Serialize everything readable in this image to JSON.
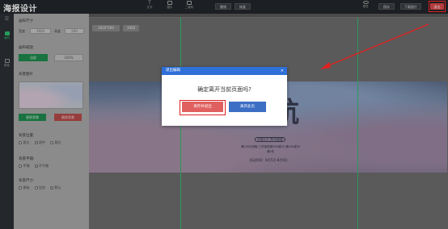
{
  "app": {
    "logo": "海报设计"
  },
  "toolbar": {
    "tools": [
      {
        "label": "文字",
        "icon": "text-icon"
      },
      {
        "label": "图片",
        "icon": "image-icon"
      },
      {
        "label": "二维码",
        "icon": "qrcode-icon"
      }
    ],
    "undo_label": "撤销",
    "redo_label": "恢复",
    "preview_label": "预览",
    "save_label": "保存",
    "download_label": "下载图片",
    "exit_label": "退出"
  },
  "strip": {
    "items": [
      {
        "label": "",
        "icon": "menu-icon"
      },
      {
        "label": "画布",
        "icon": "canvas-icon"
      },
      {
        "label": "模板",
        "icon": "template-icon"
      }
    ]
  },
  "panel": {
    "canvas_size": {
      "title": "画布尺寸",
      "width_label": "宽度",
      "width_value": "1920",
      "height_label": "高度",
      "height_value": "500"
    },
    "canvas_zoom": {
      "title": "画布缩放",
      "fit_label": "适屏",
      "full_label": "100%"
    },
    "bg_image": {
      "title": "背景图片",
      "replace_label": "更换背景",
      "delete_label": "删除背景"
    },
    "bg_position": {
      "title": "背景位置:",
      "options": [
        "居左",
        "居中",
        "居右"
      ],
      "selected": 1
    },
    "bg_repeat": {
      "title": "背景平铺:",
      "options": [
        "平铺",
        "不平铺"
      ],
      "selected": 1
    },
    "bg_size": {
      "title": "背景尺寸:",
      "options": [
        "原始",
        "包含",
        "默认"
      ],
      "selected": 2
    }
  },
  "canvas": {
    "size_tags": [
      "1920*500",
      "1920"
    ],
    "banner": {
      "title": "启航",
      "slogan": "约惠七夕 '购'你浪漫",
      "line1": "满199元领取 三件家居满199减20 满299减30",
      "line2": "满2件",
      "activity": "活动时间：8月5日-8月9日"
    }
  },
  "dialog": {
    "title": "退出编辑",
    "close": "×",
    "message": "确定离开当前页面吗?",
    "save_exit_label": "保存并退出",
    "leave_label": "离开此页"
  },
  "colors": {
    "accent_green": "#2fbf71",
    "exit_red": "#e04b4b",
    "dialog_blue": "#2e6fd8",
    "annotation_red": "#e02020"
  }
}
